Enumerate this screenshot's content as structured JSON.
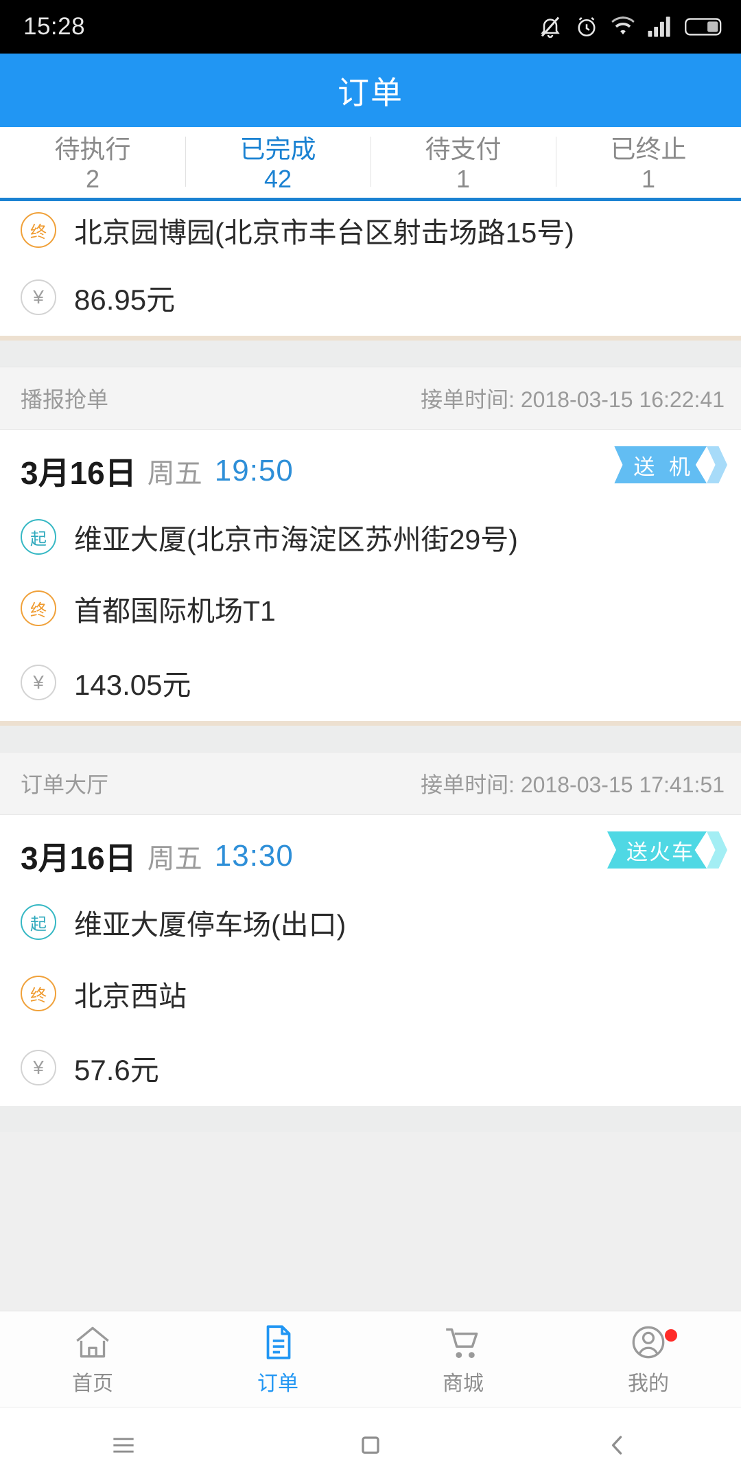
{
  "statusbar": {
    "time": "15:28",
    "icons": [
      "bell-muted-icon",
      "alarm-clock-icon",
      "wifi-icon",
      "signal-bars-icon",
      "battery-icon"
    ]
  },
  "header": {
    "title": "订单"
  },
  "tabs": [
    {
      "label": "待执行",
      "count": "2",
      "active": false
    },
    {
      "label": "已完成",
      "count": "42",
      "active": true
    },
    {
      "label": "待支付",
      "count": "1",
      "active": false
    },
    {
      "label": "已终止",
      "count": "1",
      "active": false
    }
  ],
  "labels": {
    "pin_start": "起",
    "pin_end": "终",
    "pin_fare": "¥",
    "accept_time_prefix": "接单时间:"
  },
  "colors": {
    "accent": "#2196f3",
    "tab_active": "#1b82d2",
    "time_blue": "#2e8fd8",
    "pin_start": "#2fa9bd",
    "pin_end": "#ef9a2e",
    "badge_plane": "#62bdf3",
    "badge_plane_tail": "#a7dbf9",
    "badge_train": "#4fd8e4",
    "badge_train_tail": "#a3eef4",
    "badge_notice_red": "#ff2b28",
    "card_divider": "#ede0d0"
  },
  "orders": [
    {
      "partial": true,
      "source": "",
      "accept_time": "",
      "date": "",
      "weekday": "",
      "time": "",
      "badge": "",
      "start": "",
      "end": "北京园博园(北京市丰台区射击场路15号)",
      "fare": "86.95元"
    },
    {
      "partial": false,
      "source": "播报抢单",
      "accept_time": "2018-03-15 16:22:41",
      "date": "3月16日",
      "weekday": "周五",
      "time": "19:50",
      "badge": "送 机",
      "badge_type": "plane",
      "start": "维亚大厦(北京市海淀区苏州街29号)",
      "end": "首都国际机场T1",
      "fare": "143.05元"
    },
    {
      "partial": false,
      "source": "订单大厅",
      "accept_time": "2018-03-15 17:41:51",
      "date": "3月16日",
      "weekday": "周五",
      "time": "13:30",
      "badge": "送火车",
      "badge_type": "train",
      "start": "维亚大厦停车场(出口)",
      "end": "北京西站",
      "fare": "57.6元"
    }
  ],
  "bottomnav": [
    {
      "label": "首页",
      "icon": "home-icon",
      "active": false,
      "dot": false
    },
    {
      "label": "订单",
      "icon": "document-icon",
      "active": true,
      "dot": false
    },
    {
      "label": "商城",
      "icon": "cart-icon",
      "active": false,
      "dot": false
    },
    {
      "label": "我的",
      "icon": "person-icon",
      "active": false,
      "dot": true
    }
  ],
  "androidnav": [
    "menu-icon",
    "home-square-icon",
    "back-chevron-icon"
  ]
}
